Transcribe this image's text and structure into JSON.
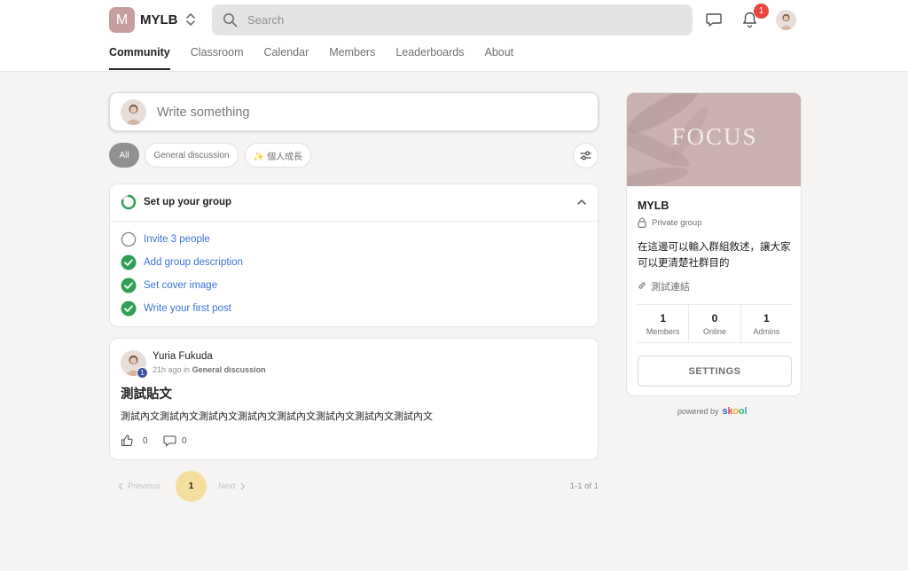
{
  "header": {
    "logo_letter": "M",
    "group_name": "MYLB",
    "search_placeholder": "Search",
    "notification_count": "1"
  },
  "tabs": [
    {
      "label": "Community",
      "active": true
    },
    {
      "label": "Classroom"
    },
    {
      "label": "Calendar"
    },
    {
      "label": "Members"
    },
    {
      "label": "Leaderboards"
    },
    {
      "label": "About"
    }
  ],
  "composer": {
    "placeholder": "Write something"
  },
  "filters": {
    "all": "All",
    "general": "General discussion",
    "personal": "✨ 個人成長"
  },
  "setup": {
    "title": "Set up your group",
    "tasks": [
      {
        "label": "Invite 3 people",
        "done": false
      },
      {
        "label": "Add group description",
        "done": true
      },
      {
        "label": "Set cover image",
        "done": true
      },
      {
        "label": "Write your first post",
        "done": true
      }
    ]
  },
  "post": {
    "author": "Yuria Fukuda",
    "level": "1",
    "time": "21h ago in",
    "category": "General discussion",
    "title": "測試貼文",
    "body": "測試內文測試內文測試內文測試內文測試內文測試內文測試內文測試內文",
    "likes": "0",
    "comments": "0"
  },
  "pagination": {
    "previous": "Previous",
    "page": "1",
    "next": "Next",
    "range": "1-1 of 1"
  },
  "sidebar": {
    "cover_text": "FOCUS",
    "name": "MYLB",
    "privacy": "Private group",
    "description": "在這邊可以輸入群組敘述，讓大家可以更清楚社群目的",
    "link": "測試連結",
    "stats": [
      {
        "value": "1",
        "label": "Members"
      },
      {
        "value": "0",
        "label": "Online"
      },
      {
        "value": "1",
        "label": "Admins"
      }
    ],
    "settings_label": "SETTINGS"
  },
  "footer": {
    "powered_by": "powered by",
    "brand": "skool"
  },
  "colors": {
    "accent_link": "#3b72d6",
    "done_green": "#2f9e52",
    "badge_red": "#e8453c",
    "page_chip": "#f5df9f"
  }
}
